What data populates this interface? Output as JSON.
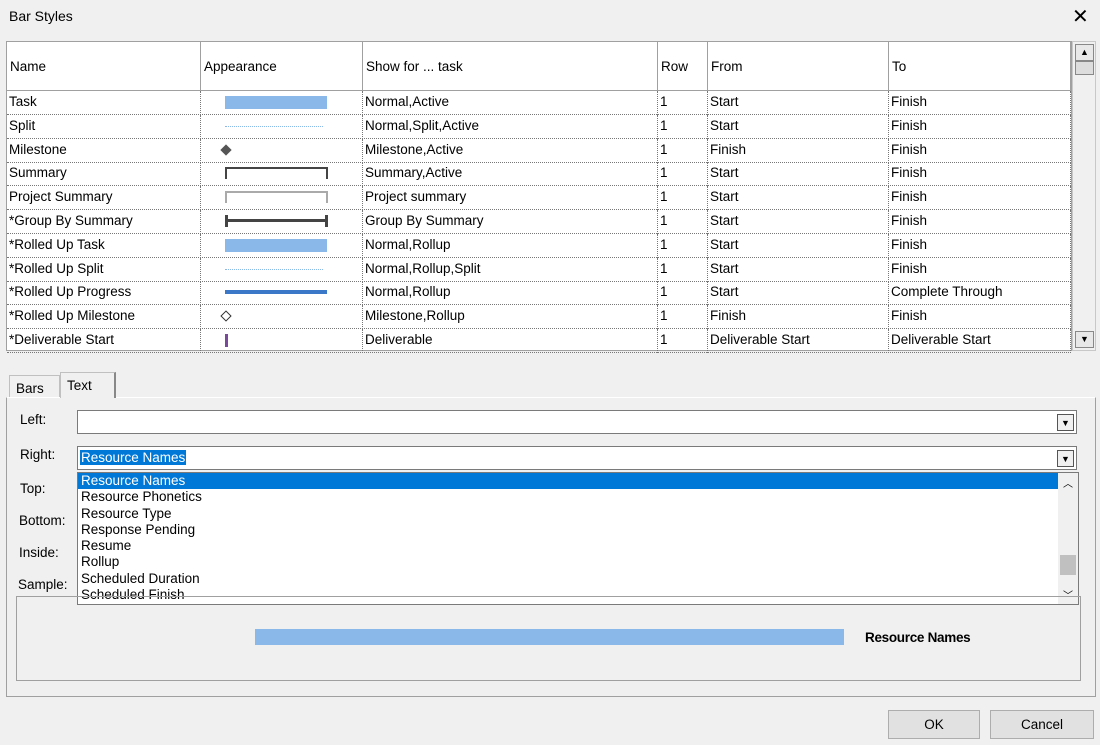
{
  "window": {
    "title": "Bar Styles",
    "close_icon": "close-icon"
  },
  "table": {
    "columns": [
      "Name",
      "Appearance",
      "Show for ... task",
      "Row",
      "From",
      "To"
    ],
    "rows": [
      {
        "name": "Task",
        "appearance": "bar",
        "show_for": "Normal,Active",
        "row": "1",
        "from": "Start",
        "to": "Finish"
      },
      {
        "name": "Split",
        "appearance": "dotted",
        "show_for": "Normal,Split,Active",
        "row": "1",
        "from": "Start",
        "to": "Finish"
      },
      {
        "name": "Milestone",
        "appearance": "diamond",
        "show_for": "Milestone,Active",
        "row": "1",
        "from": "Finish",
        "to": "Finish"
      },
      {
        "name": "Summary",
        "appearance": "summary",
        "show_for": "Summary,Active",
        "row": "1",
        "from": "Start",
        "to": "Finish"
      },
      {
        "name": "Project Summary",
        "appearance": "project-summary",
        "show_for": "Project summary",
        "row": "1",
        "from": "Start",
        "to": "Finish"
      },
      {
        "name": "*Group By Summary",
        "appearance": "group-summary",
        "show_for": "Group By Summary",
        "row": "1",
        "from": "Start",
        "to": "Finish"
      },
      {
        "name": "*Rolled Up Task",
        "appearance": "bar",
        "show_for": "Normal,Rollup",
        "row": "1",
        "from": "Start",
        "to": "Finish"
      },
      {
        "name": "*Rolled Up Split",
        "appearance": "dotted",
        "show_for": "Normal,Rollup,Split",
        "row": "1",
        "from": "Start",
        "to": "Finish"
      },
      {
        "name": "*Rolled Up Progress",
        "appearance": "progress",
        "show_for": "Normal,Rollup",
        "row": "1",
        "from": "Start",
        "to": "Complete Through"
      },
      {
        "name": "*Rolled Up Milestone",
        "appearance": "hollow-diamond",
        "show_for": "Milestone,Rollup",
        "row": "1",
        "from": "Finish",
        "to": "Finish"
      },
      {
        "name": "*Deliverable Start",
        "appearance": "deliverable",
        "show_for": "Deliverable",
        "row": "1",
        "from": "Deliverable Start",
        "to": "Deliverable Start"
      }
    ]
  },
  "tabs": [
    {
      "label": "Bars"
    },
    {
      "label": "Text",
      "active": true
    }
  ],
  "text_tab": {
    "labels": {
      "left": "Left:",
      "right": "Right:",
      "top": "Top:",
      "bottom": "Bottom:",
      "inside": "Inside:",
      "sample": "Sample:"
    },
    "left_value": "",
    "right_value": "Resource Names",
    "dropdown_options": [
      "Resource Names",
      "Resource Phonetics",
      "Resource Type",
      "Response Pending",
      "Resume",
      "Rollup",
      "Scheduled Duration",
      "Scheduled Finish"
    ],
    "selected_option": "Resource Names",
    "sample_text": "Resource Names"
  },
  "buttons": {
    "ok": "OK",
    "cancel": "Cancel"
  },
  "colors": {
    "bar": "#8ab8e8",
    "progress": "#3c78c8",
    "selection": "#0078d7",
    "deliverable": "#7a4a9a"
  }
}
